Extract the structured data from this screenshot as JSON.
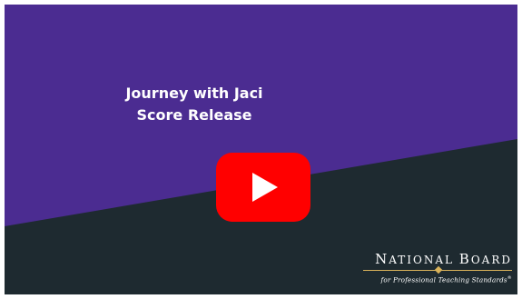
{
  "video": {
    "title_line1": "Journey with Jaci",
    "title_line2": "Score Release",
    "play_icon": "play-icon"
  },
  "logo": {
    "first_initial": "N",
    "first_rest": "ATIONAL",
    "second_initial": "B",
    "second_rest": "OARD",
    "tagline": "for Professional Teaching Standards",
    "trademark": "®"
  },
  "colors": {
    "purple": "#4b2c91",
    "dark": "#1e2a30",
    "play_red": "#ff0000",
    "accent_gold": "#d9b25a"
  }
}
